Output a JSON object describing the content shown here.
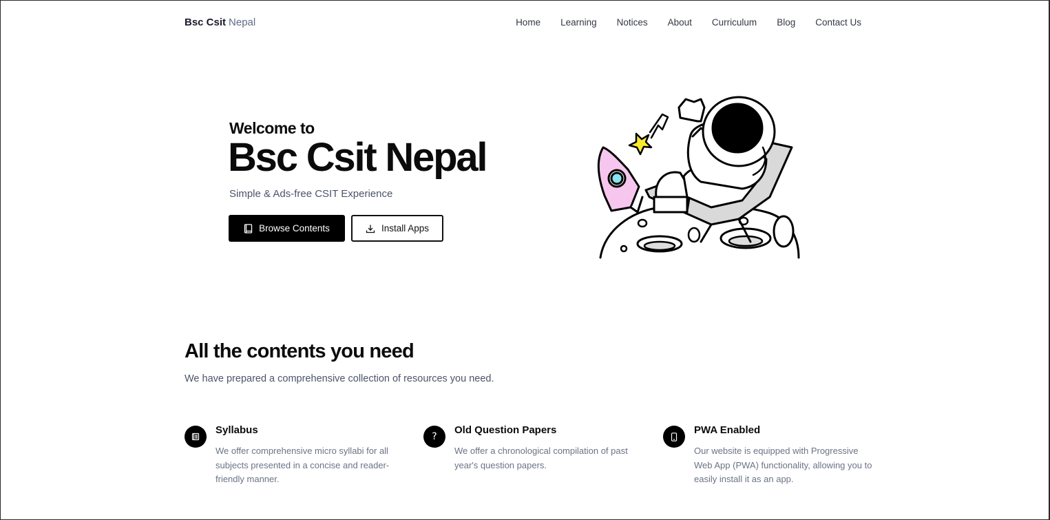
{
  "brand": {
    "bold": "Bsc Csit",
    "light": "Nepal"
  },
  "nav": [
    "Home",
    "Learning",
    "Notices",
    "About",
    "Curriculum",
    "Blog",
    "Contact Us"
  ],
  "hero": {
    "welcome": "Welcome to",
    "title": "Bsc Csit Nepal",
    "subtitle": "Simple & Ads-free CSIT Experience",
    "primary_button": "Browse Contents",
    "secondary_button": "Install Apps"
  },
  "contents": {
    "title": "All the contents you need",
    "subtitle": "We have prepared a comprehensive collection of resources you need.",
    "features": [
      {
        "title": "Syllabus",
        "icon": "book-icon",
        "description": "We offer comprehensive micro syllabi for all subjects presented in a concise and reader-friendly manner."
      },
      {
        "title": "Old Question Papers",
        "icon": "question-icon",
        "description": "We offer a chronological compilation of past year's question papers."
      },
      {
        "title": "PWA Enabled",
        "icon": "phone-icon",
        "description": "Our website is equipped with Progressive Web App (PWA) functionality, allowing you to easily install it as an app."
      }
    ]
  },
  "colors": {
    "accent": "#000000",
    "muted_text": "#6a7385",
    "brand_light": "#5f6b86",
    "rocket_pink": "#f7c6ee",
    "star_yellow": "#f9ec2c"
  }
}
